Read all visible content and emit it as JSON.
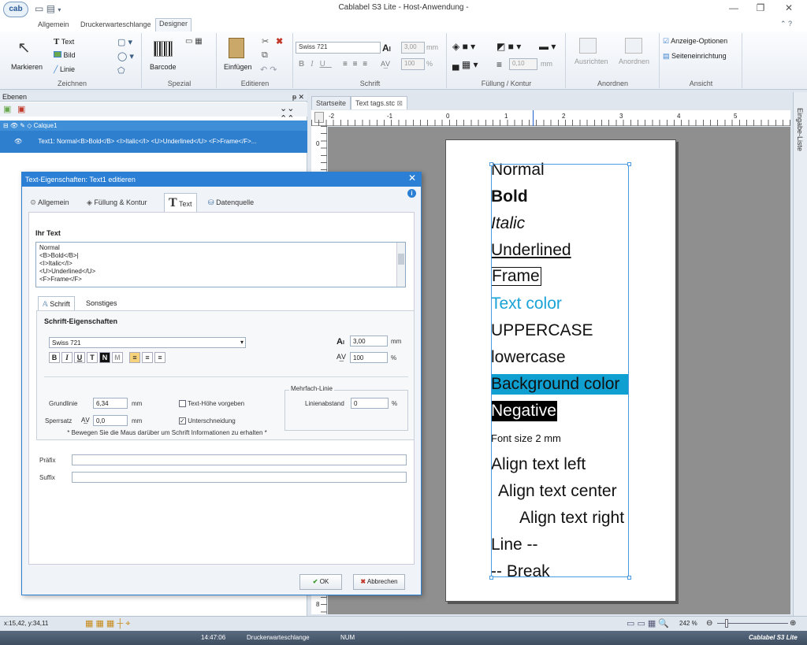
{
  "window": {
    "title": "Cablabel S3 Lite  - Host-Anwendung -",
    "logo": "cab"
  },
  "ribbon_tabs": [
    "Allgemein",
    "Druckerwarteschlange",
    "Designer"
  ],
  "ribbon": {
    "zeichnen": {
      "label": "Zeichnen",
      "markieren": "Markieren",
      "text": "Text",
      "bild": "Bild",
      "linie": "Linie"
    },
    "spezial": {
      "label": "Spezial",
      "barcode": "Barcode"
    },
    "editieren": {
      "label": "Editieren",
      "einfuegen": "Einfügen"
    },
    "schrift": {
      "label": "Schrift",
      "font": "Swiss 721",
      "size": "3,00",
      "size_unit": "mm",
      "width": "100",
      "width_unit": "%"
    },
    "fuellung": {
      "label": "Füllung / Kontur",
      "line_width": "0,10",
      "line_unit": "mm"
    },
    "anordnen": {
      "label": "Anordnen",
      "ausrichten": "Ausrichten",
      "anordnen": "Anordnen"
    },
    "ansicht": {
      "label": "Ansicht",
      "anzeige": "Anzeige-Optionen",
      "seite": "Seiteneinrichtung"
    }
  },
  "layers": {
    "title": "Ebenen",
    "layer_name": "Calque1",
    "item": "Text1: Normal<B>Bold</B> <I>Italic</I> <U>Underlined</U> <F>Frame</F>..."
  },
  "doc_tabs": [
    "Startseite",
    "Text tags.stc"
  ],
  "ruler_h": [
    "-2",
    "-1",
    "0",
    "1",
    "2",
    "3",
    "4",
    "5"
  ],
  "ruler_v": [
    "0",
    "8"
  ],
  "label_lines": [
    "Normal",
    "Bold",
    "Italic",
    "Underlined",
    "Frame",
    "Text color",
    "UPPERCASE",
    "lowercase",
    "Background color",
    "Negative",
    "Font size 2 mm",
    "Align text left",
    "Align text center",
    "Align text right",
    "Line --",
    "-- Break"
  ],
  "side_panel": "Eingabe-Liste",
  "dialog": {
    "title": "Text-Eigenschaften: Text1 editieren",
    "tabs": [
      "Allgemein",
      "Füllung & Kontur",
      "Text",
      "Datenquelle"
    ],
    "ihr_text_label": "Ihr Text",
    "text_lines": [
      "Normal",
      "<B>Bold</B>|",
      "<I>Italic</I>",
      "<U>Underlined</U>",
      "<F>Frame</F>"
    ],
    "sub_tabs": [
      "Schrift",
      "Sonstiges"
    ],
    "font_props_label": "Schrift-Eigenschaften",
    "font": "Swiss 721",
    "size": "3,00",
    "size_unit": "mm",
    "width": "100",
    "width_unit": "%",
    "grundlinie_label": "Grundlinie",
    "grundlinie": "6,34",
    "grundlinie_unit": "mm",
    "sperrsatz_label": "Sperrsatz",
    "sperrsatz": "0,0",
    "sperrsatz_unit": "mm",
    "texthoehe_label": "Text-Höhe vorgeben",
    "unterschneidung_label": "Unterschneidung",
    "mehrfach_label": "Mehrfach-Linie",
    "linienabstand_label": "Linienabstand",
    "linienabstand": "0",
    "linienabstand_unit": "%",
    "hint": "* Bewegen Sie die Maus darüber um Schrift Informationen zu erhalten *",
    "praefix_label": "Präfix",
    "suffix_label": "Suffix",
    "ok": "OK",
    "cancel": "Abbrechen"
  },
  "status": {
    "coords": "x:15,42, y:34,11",
    "zoom": "242 %",
    "time": "14:47:06",
    "queue": "Druckerwarteschlange",
    "num": "NUM",
    "brand": "Cablabel S3 Lite"
  },
  "colors": {
    "accent": "#2b80d5",
    "text_color": "#1aa3d6",
    "bg_color": "#0f9fd1"
  }
}
